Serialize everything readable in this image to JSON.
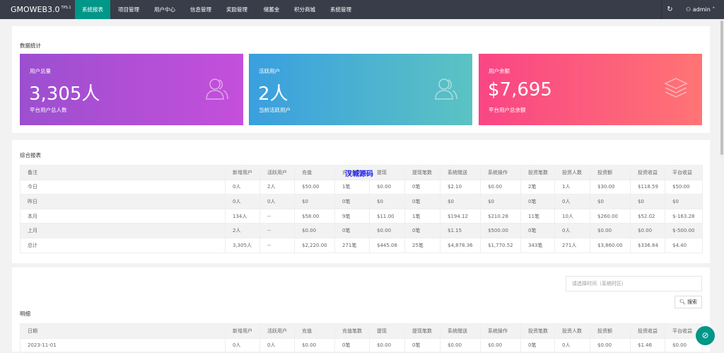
{
  "nav": {
    "logo": "GMOWEB3.0",
    "version": "TPS.1",
    "tabs": [
      "系统报表",
      "项目管理",
      "用户中心",
      "信息管理",
      "奖励管理",
      "储蓄金",
      "积分商城",
      "系统管理"
    ],
    "user": "admin"
  },
  "stats": {
    "title": "数据统计",
    "cards": [
      {
        "label": "用户总量",
        "value": "3,305人",
        "sub": "平台用户总人数",
        "icon": "users-icon"
      },
      {
        "label": "活跃用户",
        "value": "2人",
        "sub": "当前活跃用户",
        "icon": "users-icon"
      },
      {
        "label": "用户余额",
        "value": "$7,695",
        "sub": "平台用户总余额",
        "icon": "layers-icon"
      }
    ]
  },
  "report": {
    "title": "综合报表",
    "watermark": "汉城源码",
    "headers": [
      "备注",
      "新增用户",
      "活跃用户",
      "充值",
      "充值笔数",
      "提现",
      "提现笔数",
      "系统赠送",
      "系统操作",
      "投资笔数",
      "投资人数",
      "投资额",
      "投资收益",
      "平台收益"
    ],
    "rows": [
      [
        "今日",
        "0人",
        "2人",
        "$50.00",
        "1笔",
        "$0.00",
        "0笔",
        "$2.10",
        "$0.00",
        "2笔",
        "1人",
        "$30.00",
        "$118.59",
        "$50.00"
      ],
      [
        "昨日",
        "0人",
        "0人",
        "$0",
        "0笔",
        "$0",
        "0笔",
        "$0",
        "$0",
        "0笔",
        "0人",
        "$0",
        "$0",
        "$0"
      ],
      [
        "本月",
        "134人",
        "--",
        "$58.00",
        "9笔",
        "$11.00",
        "1笔",
        "$194.12",
        "$210.28",
        "11笔",
        "10人",
        "$260.00",
        "$52.02",
        "$-163.28"
      ],
      [
        "上月",
        "2人",
        "--",
        "$0.00",
        "0笔",
        "$0.00",
        "0笔",
        "$1.15",
        "$500.00",
        "0笔",
        "0人",
        "$0.00",
        "$0.00",
        "$-500.00"
      ],
      [
        "总计",
        "3,305人",
        "--",
        "$2,220.00",
        "271笔",
        "$445.08",
        "25笔",
        "$4,878.36",
        "$1,770.52",
        "343笔",
        "271人",
        "$3,860.00",
        "$336.84",
        "$4.40"
      ]
    ]
  },
  "detail": {
    "title": "明细",
    "date_placeholder": "请选择时间（系统时区）",
    "search_label": "搜索",
    "headers": [
      "日期",
      "新增用户",
      "活跃用户",
      "充值",
      "充值笔数",
      "提现",
      "提现笔数",
      "系统赠送",
      "系统操作",
      "投资笔数",
      "投资人数",
      "投资额",
      "投资收益",
      "平台收益"
    ],
    "rows": [
      [
        "2023-11-01",
        "0人",
        "0人",
        "$0.00",
        "0笔",
        "$0.00",
        "0笔",
        "$0.00",
        "$0.00",
        "0笔",
        "0人",
        "$0.00",
        "$1.46",
        "$0.00"
      ]
    ]
  }
}
